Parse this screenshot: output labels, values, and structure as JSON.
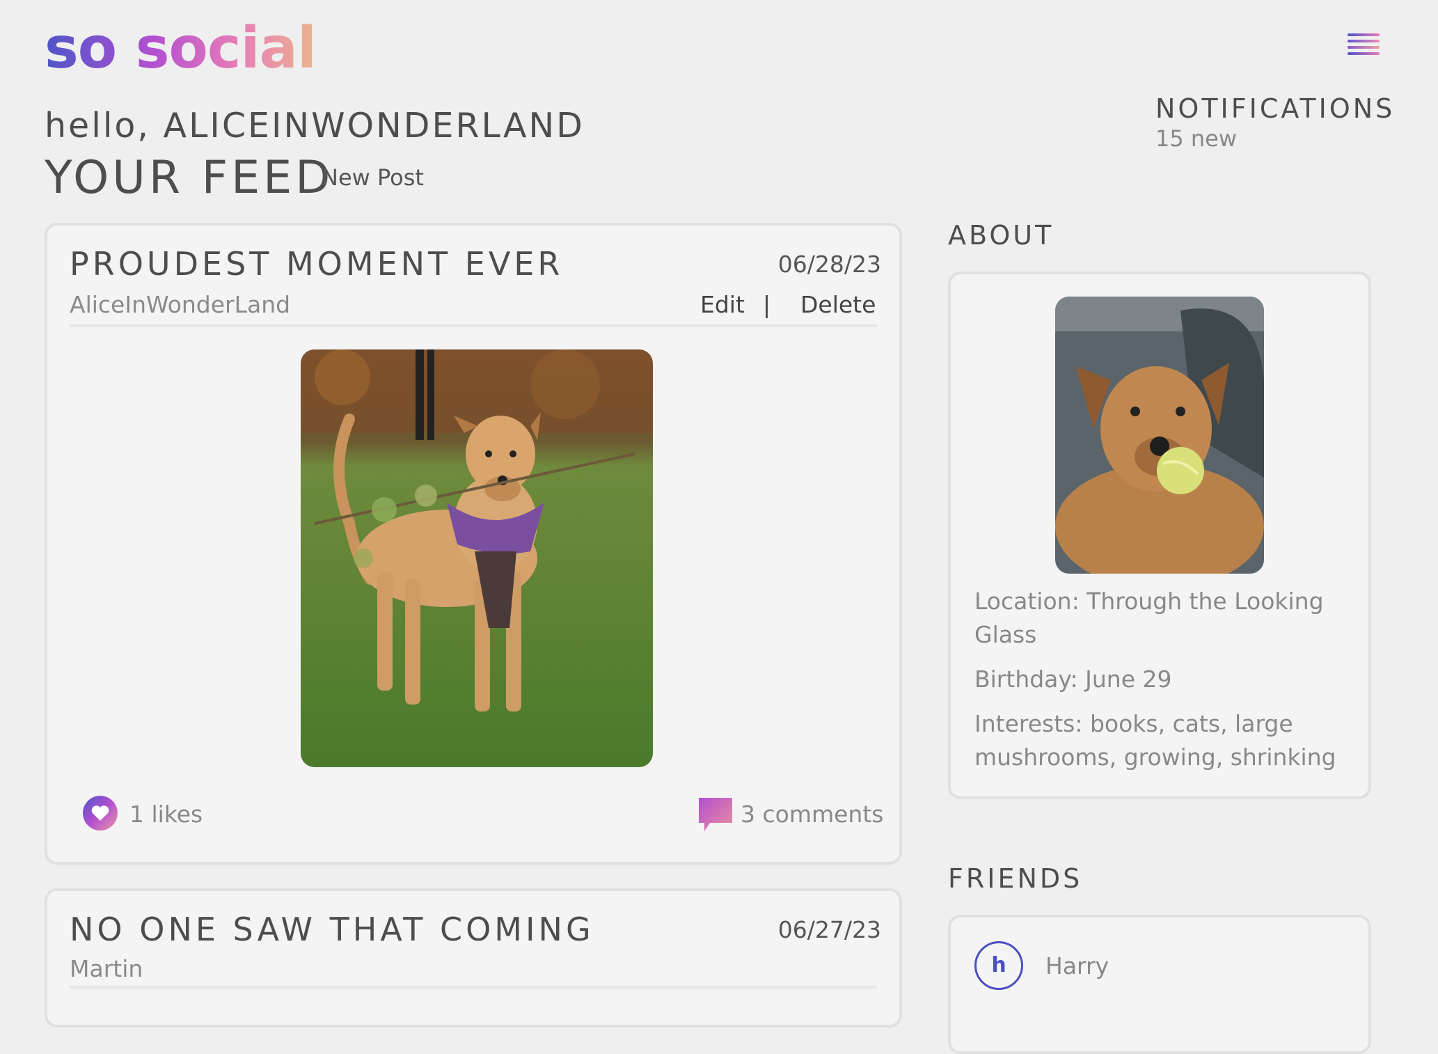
{
  "app": {
    "logo": "so social"
  },
  "header": {
    "greeting": "hello, ALICEINWONDERLAND",
    "feed_title": "YOUR FEED",
    "new_post_label": "New Post"
  },
  "notifications": {
    "title": "NOTIFICATIONS",
    "count": "15 new"
  },
  "posts": [
    {
      "title": "PROUDEST MOMENT EVER",
      "date": "06/28/23",
      "author": "AliceInWonderLand",
      "edit_label": "Edit",
      "separator": "|",
      "delete_label": "Delete",
      "likes": "1 likes",
      "comments": "3 comments"
    },
    {
      "title": "NO ONE SAW THAT COMING",
      "date": "06/27/23",
      "author": "Martin"
    }
  ],
  "about": {
    "title": "ABOUT",
    "location": "Location: Through the Looking Glass",
    "birthday": "Birthday: June 29",
    "interests": "Interests: books, cats, large mushrooms, growing, shrinking"
  },
  "friends": {
    "title": "FRIENDS",
    "items": [
      {
        "initial": "h",
        "name": "Harry"
      }
    ]
  },
  "colors": {
    "accent": "#4a50c0",
    "brand_gradient": [
      "#4f55c9",
      "#b24fd0",
      "#eeb38e"
    ]
  }
}
